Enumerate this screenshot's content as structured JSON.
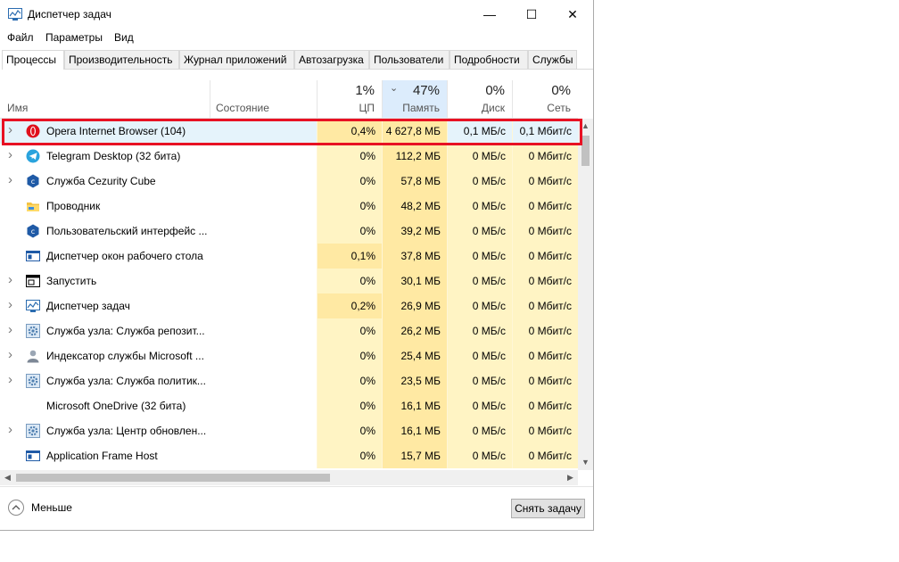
{
  "window": {
    "title": "Диспетчер задач",
    "controls": {
      "minimize": "—",
      "maximize": "☐",
      "close": "✕"
    }
  },
  "menu": [
    "Файл",
    "Параметры",
    "Вид"
  ],
  "tabs": [
    "Процессы",
    "Производительность",
    "Журнал приложений",
    "Автозагрузка",
    "Пользователи",
    "Подробности",
    "Службы"
  ],
  "active_tab": "Процессы",
  "columns": {
    "name": "Имя",
    "status": "Состояние",
    "cpu": {
      "pct": "1%",
      "label": "ЦП"
    },
    "memory": {
      "pct": "47%",
      "label": "Память",
      "sorted": true
    },
    "disk": {
      "pct": "0%",
      "label": "Диск"
    },
    "network": {
      "pct": "0%",
      "label": "Сеть"
    }
  },
  "processes": [
    {
      "name": "Opera Internet Browser (104)",
      "icon": "opera-icon",
      "expandable": true,
      "cpu": "0,4%",
      "mem": "4 627,8 МБ",
      "disk": "0,1 МБ/с",
      "net": "0,1 Мбит/с"
    },
    {
      "name": "Telegram Desktop (32 бита)",
      "icon": "telegram-icon",
      "expandable": true,
      "cpu": "0%",
      "mem": "112,2 МБ",
      "disk": "0 МБ/с",
      "net": "0 Мбит/с"
    },
    {
      "name": "Служба Cezurity Cube",
      "icon": "cezurity-icon",
      "expandable": true,
      "cpu": "0%",
      "mem": "57,8 МБ",
      "disk": "0 МБ/с",
      "net": "0 Мбит/с"
    },
    {
      "name": "Проводник",
      "icon": "folder-icon",
      "expandable": false,
      "cpu": "0%",
      "mem": "48,2 МБ",
      "disk": "0 МБ/с",
      "net": "0 Мбит/с"
    },
    {
      "name": "Пользовательский интерфейс ...",
      "icon": "cezurity-icon",
      "expandable": false,
      "cpu": "0%",
      "mem": "39,2 МБ",
      "disk": "0 МБ/с",
      "net": "0 Мбит/с"
    },
    {
      "name": "Диспетчер окон рабочего стола",
      "icon": "window-icon",
      "expandable": false,
      "cpu": "0,1%",
      "mem": "37,8 МБ",
      "disk": "0 МБ/с",
      "net": "0 Мбит/с"
    },
    {
      "name": "Запустить",
      "icon": "run-icon",
      "expandable": true,
      "cpu": "0%",
      "mem": "30,1 МБ",
      "disk": "0 МБ/с",
      "net": "0 Мбит/с"
    },
    {
      "name": "Диспетчер задач",
      "icon": "taskmgr-icon",
      "expandable": true,
      "cpu": "0,2%",
      "mem": "26,9 МБ",
      "disk": "0 МБ/с",
      "net": "0 Мбит/с"
    },
    {
      "name": "Служба узла: Служба репозит...",
      "icon": "gear-icon",
      "expandable": true,
      "cpu": "0%",
      "mem": "26,2 МБ",
      "disk": "0 МБ/с",
      "net": "0 Мбит/с"
    },
    {
      "name": "Индексатор службы Microsoft ...",
      "icon": "user-icon",
      "expandable": true,
      "cpu": "0%",
      "mem": "25,4 МБ",
      "disk": "0 МБ/с",
      "net": "0 Мбит/с"
    },
    {
      "name": "Служба узла: Служба политик...",
      "icon": "gear-icon",
      "expandable": true,
      "cpu": "0%",
      "mem": "23,5 МБ",
      "disk": "0 МБ/с",
      "net": "0 Мбит/с"
    },
    {
      "name": "Microsoft OneDrive (32 бита)",
      "icon": "",
      "expandable": false,
      "cpu": "0%",
      "mem": "16,1 МБ",
      "disk": "0 МБ/с",
      "net": "0 Мбит/с"
    },
    {
      "name": "Служба узла: Центр обновлен...",
      "icon": "gear-icon",
      "expandable": true,
      "cpu": "0%",
      "mem": "16,1 МБ",
      "disk": "0 МБ/с",
      "net": "0 Мбит/с"
    },
    {
      "name": "Application Frame Host",
      "icon": "window-icon",
      "expandable": false,
      "cpu": "0%",
      "mem": "15,7 МБ",
      "disk": "0 МБ/с",
      "net": "0 Мбит/с"
    }
  ],
  "footer": {
    "less_label": "Меньше",
    "end_task_label": "Снять задачу"
  },
  "colors": {
    "heat_light": "#fff4c4",
    "heat_mid": "#ffe9a3",
    "highlight": "#e81123",
    "selected_row": "#e5f3fb"
  }
}
